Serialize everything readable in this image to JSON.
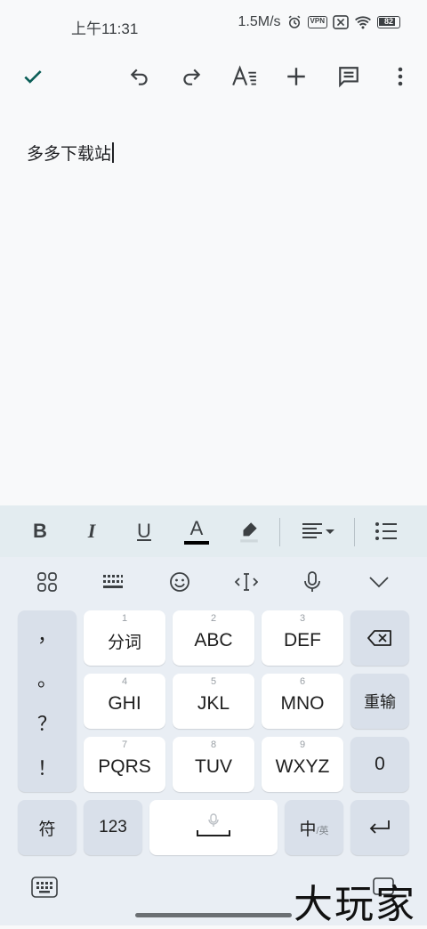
{
  "status_bar": {
    "time": "上午11:31",
    "speed": "1.5M/s",
    "vpn": "VPN",
    "battery": "82"
  },
  "toolbar": {
    "icons": [
      "check-icon",
      "undo-icon",
      "redo-icon",
      "text-format-icon",
      "add-icon",
      "comment-icon",
      "more-vert-icon"
    ]
  },
  "document": {
    "text": "多多下载站"
  },
  "format_bar": {
    "bold": "B",
    "italic": "I",
    "underline": "U",
    "text_color": "A",
    "text_color_value": "#000000"
  },
  "keyboard": {
    "punctuation": [
      "，",
      "。",
      "？",
      "！"
    ],
    "keys": [
      {
        "num": "1",
        "label": "分词"
      },
      {
        "num": "2",
        "label": "ABC"
      },
      {
        "num": "3",
        "label": "DEF"
      },
      {
        "num": "4",
        "label": "GHI"
      },
      {
        "num": "5",
        "label": "JKL"
      },
      {
        "num": "6",
        "label": "MNO"
      },
      {
        "num": "7",
        "label": "PQRS"
      },
      {
        "num": "8",
        "label": "TUV"
      },
      {
        "num": "9",
        "label": "WXYZ"
      }
    ],
    "reenter": "重输",
    "zero": "0",
    "symbol": "符",
    "num123": "123",
    "lang_main": "中",
    "lang_sub": "/英"
  },
  "watermark": "大玩家"
}
